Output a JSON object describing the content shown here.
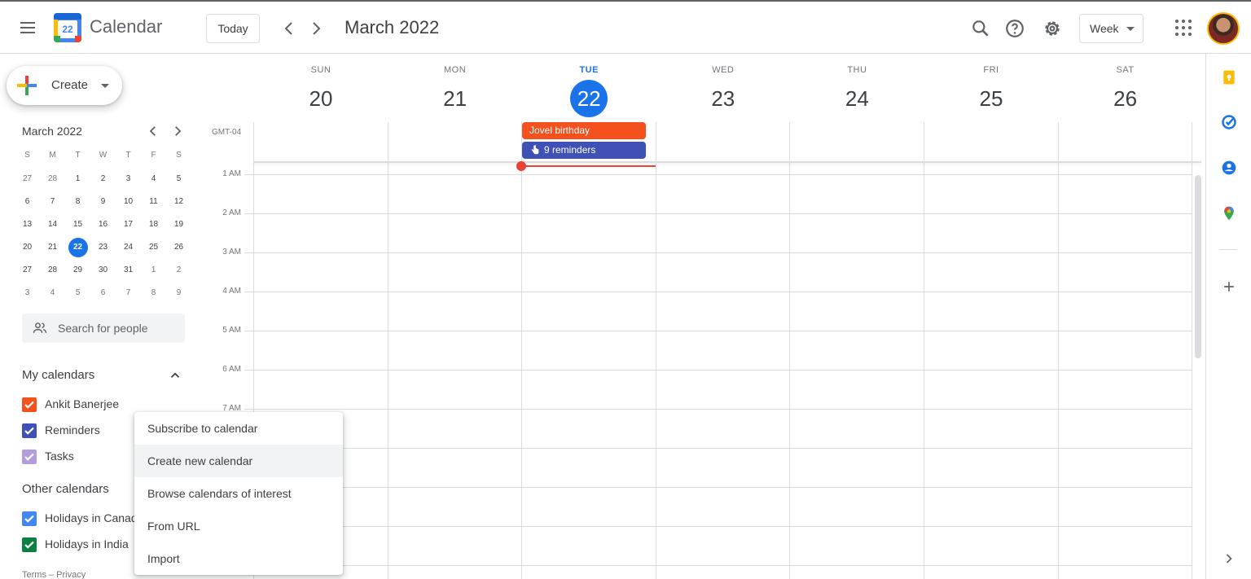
{
  "header": {
    "app_name": "Calendar",
    "logo_day": "22",
    "today_label": "Today",
    "current_period": "March 2022",
    "view_label": "Week",
    "icons": [
      "menu-icon",
      "search-icon",
      "help-icon",
      "settings-icon",
      "apps-icon",
      "avatar"
    ]
  },
  "sidebar": {
    "create_label": "Create",
    "mini_calendar": {
      "title": "March 2022",
      "weekdays": [
        "S",
        "M",
        "T",
        "W",
        "T",
        "F",
        "S"
      ],
      "weeks": [
        [
          "27",
          "28",
          "1",
          "2",
          "3",
          "4",
          "5"
        ],
        [
          "6",
          "7",
          "8",
          "9",
          "10",
          "11",
          "12"
        ],
        [
          "13",
          "14",
          "15",
          "16",
          "17",
          "18",
          "19"
        ],
        [
          "20",
          "21",
          "22",
          "23",
          "24",
          "25",
          "26"
        ],
        [
          "27",
          "28",
          "29",
          "30",
          "31",
          "1",
          "2"
        ],
        [
          "3",
          "4",
          "5",
          "6",
          "7",
          "8",
          "9"
        ]
      ],
      "today": "22"
    },
    "search_placeholder": "Search for people",
    "my_calendars_title": "My calendars",
    "my_calendars": [
      {
        "name": "Ankit Banerjee",
        "color": "#f4511e"
      },
      {
        "name": "Reminders",
        "color": "#3f51b5"
      },
      {
        "name": "Tasks",
        "color": "#b39ddb"
      }
    ],
    "other_calendars_title": "Other calendars",
    "other_calendars": [
      {
        "name": "Holidays in Canada",
        "color": "#4285f4"
      },
      {
        "name": "Holidays in India",
        "color": "#0b8043"
      }
    ],
    "footer": "Terms – Privacy"
  },
  "week": {
    "timezone": "GMT-04",
    "days": [
      {
        "dow": "SUN",
        "num": "20"
      },
      {
        "dow": "MON",
        "num": "21"
      },
      {
        "dow": "TUE",
        "num": "22",
        "today": true
      },
      {
        "dow": "WED",
        "num": "23"
      },
      {
        "dow": "THU",
        "num": "24"
      },
      {
        "dow": "FRI",
        "num": "25"
      },
      {
        "dow": "SAT",
        "num": "26"
      }
    ],
    "hours": [
      "1 AM",
      "2 AM",
      "3 AM",
      "4 AM",
      "5 AM",
      "6 AM",
      "7 AM"
    ],
    "all_day_events": [
      {
        "title": "Jovel birthday",
        "color": "#f4511e"
      },
      {
        "title": "9 reminders",
        "color": "#3f51b5"
      }
    ]
  },
  "context_menu": {
    "items": [
      "Subscribe to calendar",
      "Create new calendar",
      "Browse calendars of interest",
      "From URL",
      "Import"
    ],
    "highlighted_index": 1
  },
  "side_panel": {
    "icons": [
      "keep-icon",
      "tasks-icon",
      "contacts-icon",
      "maps-icon",
      "add-addon-icon",
      "expand-panel-icon"
    ]
  }
}
